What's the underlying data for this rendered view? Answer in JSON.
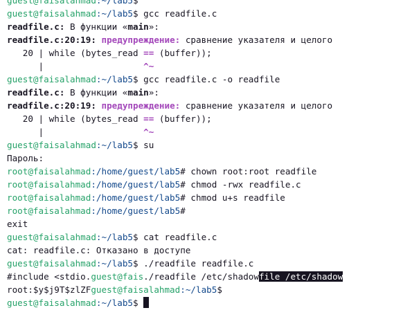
{
  "user_host": "guest@faisalahmad",
  "root_host": "root@faisalahmad",
  "home_dir": ":~/lab5",
  "root_dir": ":/home/guest/lab5",
  "user_sign": "$",
  "root_sign": "#",
  "commands": {
    "gcc1": " gcc readfile.c",
    "gcc2": " gcc readfile.c -o readfile",
    "su": " su",
    "chown": " chown root:root readfile",
    "chmod_rwx": " chmod -rwx readfile.c",
    "chmod_us": " chmod u+s readfile",
    "cat": " cat readfile.c",
    "run": " ./readfile readfile.c"
  },
  "compiler": {
    "file": "readfile.c:",
    "func_prefix": " В функции «",
    "func_name": "main",
    "func_suffix": "»:",
    "loc": "readfile.c:20:19:",
    "warning_label": "предупреждение:",
    "warning_text": " сравнение указателя и целого",
    "code_pre": "   20 | while (bytes_read ",
    "code_op": "==",
    "code_post": " (buffer));",
    "marker_pre": "      |                   ",
    "marker": "^~"
  },
  "password_prompt": "Пароль:",
  "exit_text": "exit",
  "cat_error": "cat: readfile.c: Отказано в доступе",
  "output": {
    "include_text": "#include <stdio.",
    "include_host_part": "guest@fais",
    "include_cmd": "./readfile /etc/shadow",
    "include_highlight": "file /etc/shadow",
    "root_hash": "root:$y$j9T$zlZF"
  }
}
